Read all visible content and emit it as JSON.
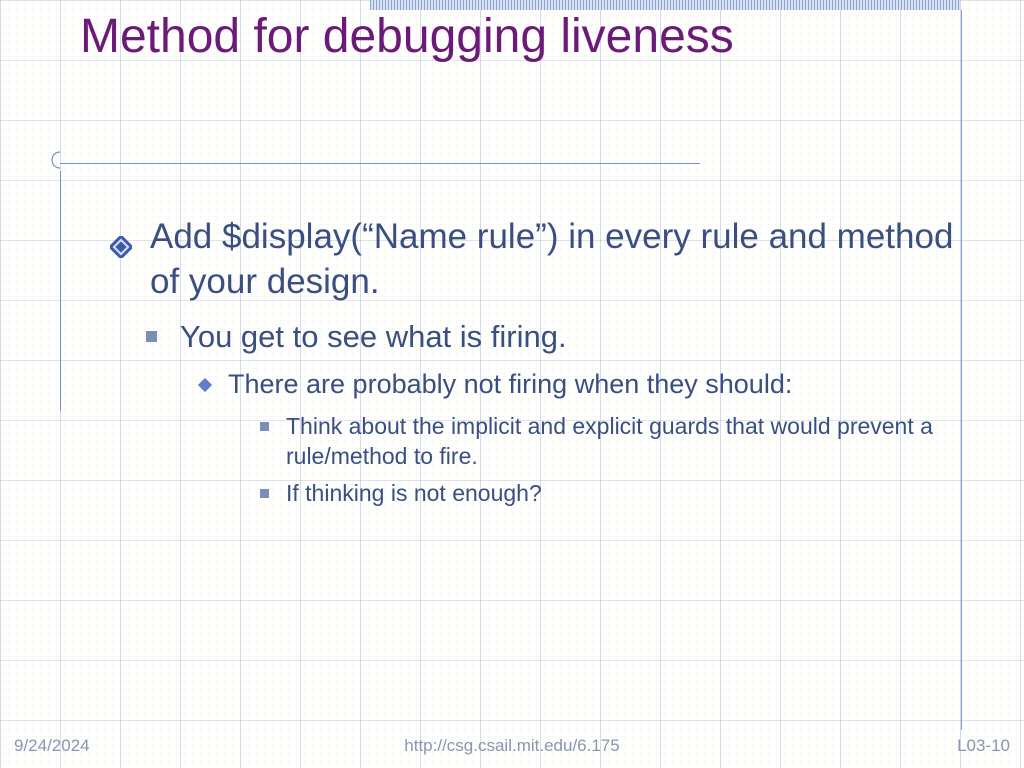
{
  "title": "Method for debugging liveness",
  "bullets": {
    "l1": "Add $display(“Name rule”) in every rule and method of your design.",
    "l2": "You get to see what is firing.",
    "l3": "There are probably not firing when they should:",
    "l4a": "Think about the implicit and explicit guards that would prevent a rule/method to fire.",
    "l4b": "If thinking is not enough?"
  },
  "footer": {
    "date": "9/24/2024",
    "url": "http://csg.csail.mit.edu/6.175",
    "page": "L03-10"
  },
  "colors": {
    "title": "#6b1a78",
    "body": "#3a4f80",
    "accent": "#5e7fc8"
  }
}
